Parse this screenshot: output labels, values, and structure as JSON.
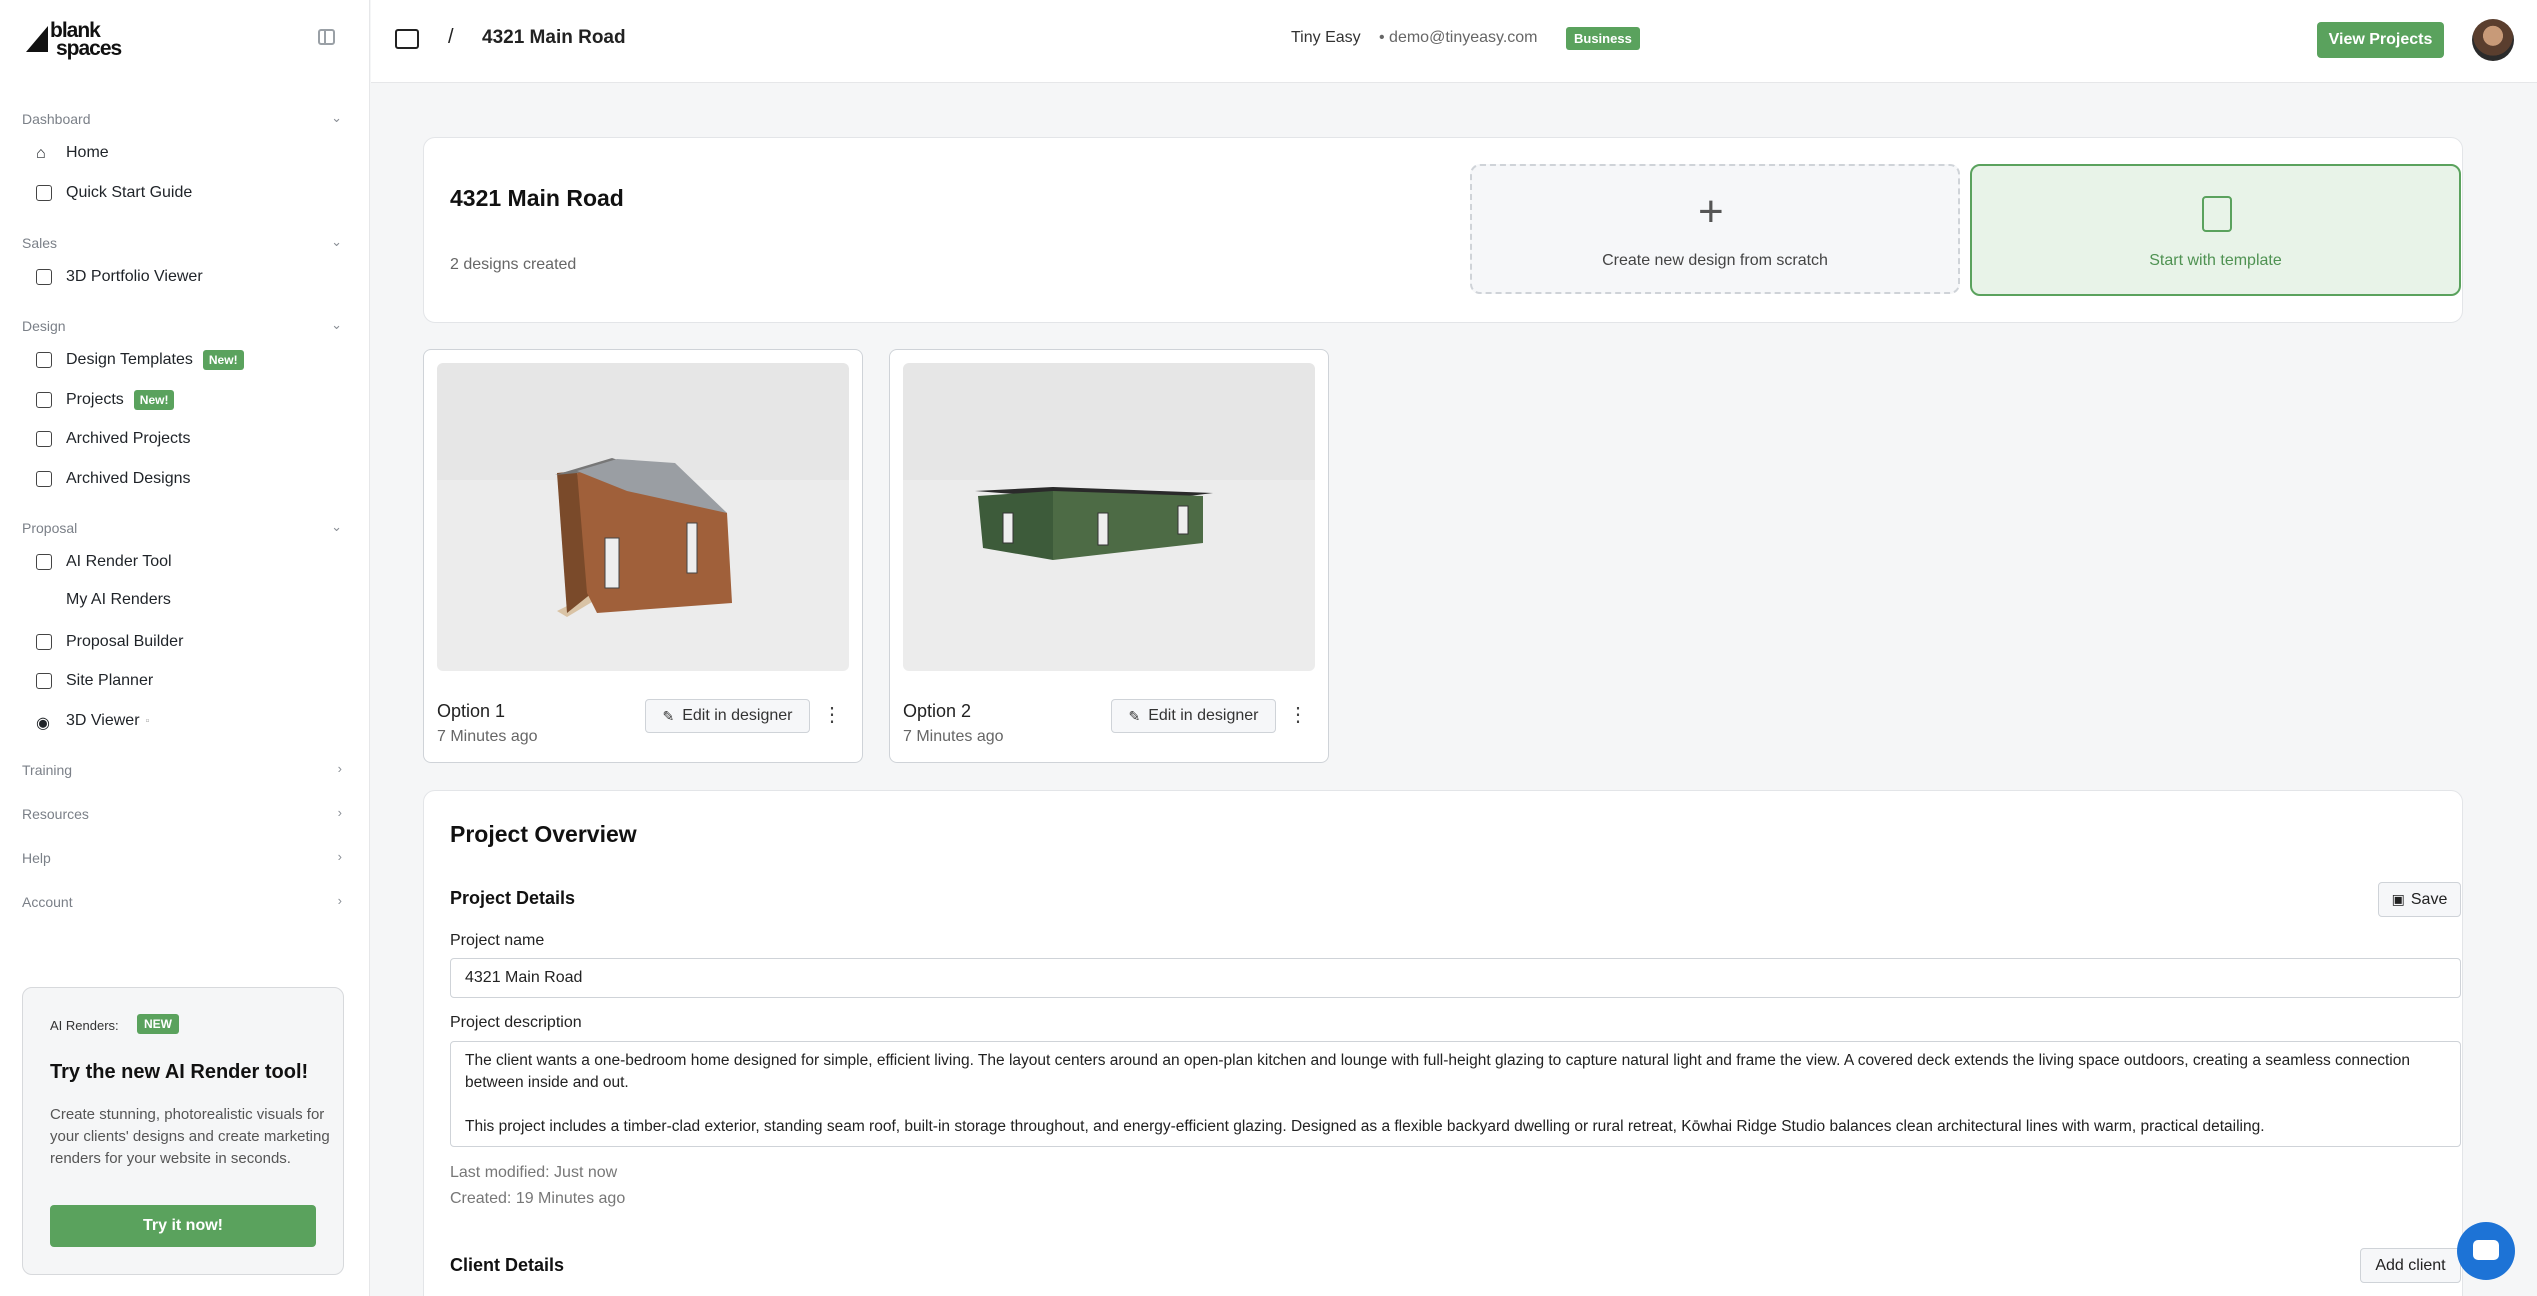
{
  "brand": {
    "line1": "blank",
    "line2": "spaces"
  },
  "sidebar": {
    "sections": [
      {
        "label": "Dashboard"
      },
      {
        "label": "Sales"
      },
      {
        "label": "Design"
      },
      {
        "label": "Proposal"
      },
      {
        "label": "Training"
      },
      {
        "label": "Resources"
      },
      {
        "label": "Help"
      },
      {
        "label": "Account"
      }
    ],
    "items": {
      "home": "Home",
      "quick_start": "Quick Start Guide",
      "portfolio": "3D Portfolio Viewer",
      "design_templates": "Design Templates",
      "projects": "Projects",
      "archived_projects": "Archived Projects",
      "archived_designs": "Archived Designs",
      "ai_render_tool": "AI Render Tool",
      "my_ai_renders": "My AI Renders",
      "proposal_builder": "Proposal Builder",
      "site_planner": "Site Planner",
      "viewer_3d": "3D Viewer"
    },
    "new_badge": "New!",
    "promo": {
      "label": "AI Renders:",
      "tag": "NEW",
      "title": "Try the new AI Render tool!",
      "body": "Create stunning, photorealistic visuals for your clients' designs and create marketing renders for your website in seconds.",
      "cta": "Try it now!"
    }
  },
  "header": {
    "separator": "/",
    "title": "4321 Main Road",
    "company": "Tiny Easy",
    "email": "• demo@tinyeasy.com",
    "plan": "Business",
    "view_projects": "View Projects"
  },
  "project": {
    "title": "4321 Main Road",
    "designs_count": "2 designs created",
    "new_design_label": "Create new design from scratch",
    "template_label": "Start with template",
    "designs": [
      {
        "name": "Option 1",
        "time": "7 Minutes ago",
        "edit": "Edit in designer"
      },
      {
        "name": "Option 2",
        "time": "7 Minutes ago",
        "edit": "Edit in designer"
      }
    ]
  },
  "overview": {
    "title": "Project Overview",
    "details_title": "Project Details",
    "save": "Save",
    "name_label": "Project name",
    "name_value": "4321 Main Road",
    "desc_label": "Project description",
    "desc_p1": "The client wants a one-bedroom home designed for simple, efficient living. The layout centers around an open-plan kitchen and lounge with full-height glazing to capture natural light and frame the view. A covered deck extends the living space outdoors, creating a seamless connection between inside and out.",
    "desc_p2": "This project includes a timber-clad exterior, standing seam roof, built-in storage throughout, and energy-efficient glazing. Designed as a flexible backyard dwelling or rural retreat, Kōwhai Ridge Studio balances clean architectural lines with warm, practical detailing.",
    "last_modified": "Last modified: Just now",
    "created": "Created: 19 Minutes ago",
    "client_title": "Client Details",
    "add_client": "Add client"
  },
  "colors": {
    "accent": "#5aa25d",
    "chat": "#1d73d6"
  }
}
